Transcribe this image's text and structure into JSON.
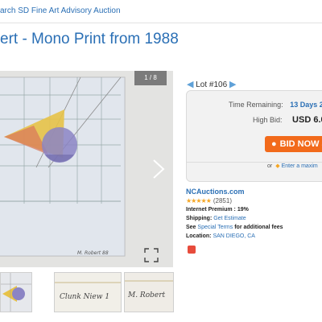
{
  "breadcrumb": "arch SD Fine Art Advisory Auction",
  "title": "ert - Mono Print from 1988",
  "viewer": {
    "counter": "1 / 8",
    "signature": "M. Robert 88",
    "icons": {
      "next": "chevron-right-icon",
      "expand": "expand-icon"
    }
  },
  "thumbnails": [
    {
      "caption": ""
    },
    {
      "caption": "Clunk Niew 1"
    },
    {
      "caption": "M. Robert"
    }
  ],
  "lot_nav": {
    "prev": "◀",
    "label": "Lot #106",
    "next": "▶"
  },
  "bid_panel": {
    "time_label": "Time Remaining:",
    "time_value": "13 Days 20",
    "high_bid_label": "High Bid:",
    "high_bid_value": "USD 6.0",
    "bid_button": "BID NOW $",
    "or_text": "or",
    "max_link": "Enter a maxim"
  },
  "seller": {
    "name": "NCAuctions.com",
    "stars": "★★★★★",
    "rating_count": "(2851)",
    "premium_label": "Internet Premium :",
    "premium_value": "19%",
    "shipping_label": "Shipping:",
    "shipping_value": "Get Estimate",
    "see_label": "See",
    "special_terms": "Special Terms",
    "fees_text": "for additional fees",
    "location_label": "Location:",
    "location_value": "SAN DIEGO, CA"
  },
  "colors": {
    "link": "#2a6fb5",
    "accent": "#f26a1b",
    "star": "#f5a623"
  }
}
